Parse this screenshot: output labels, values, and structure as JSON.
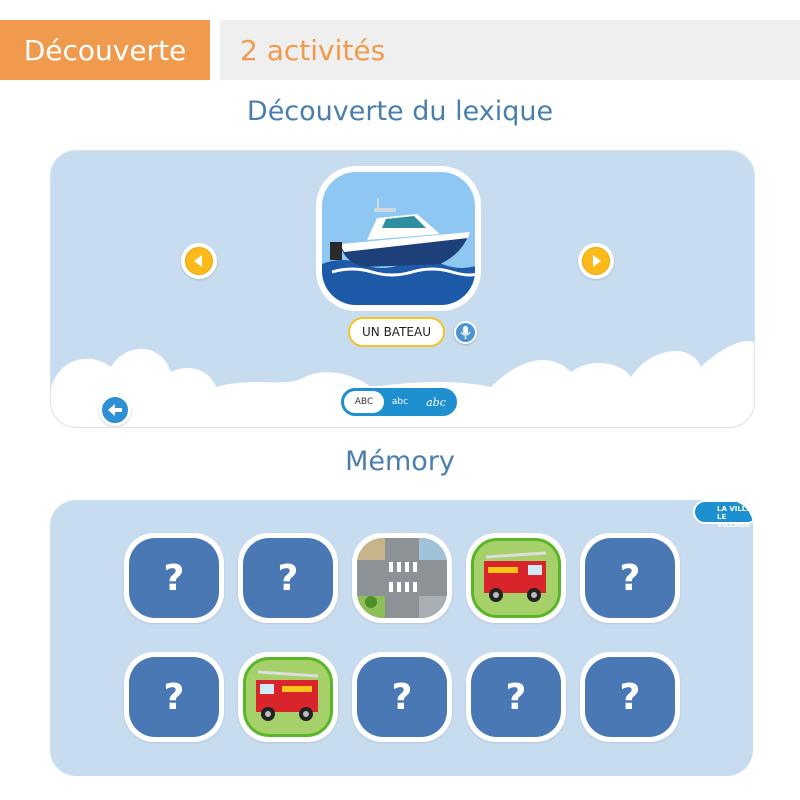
{
  "header": {
    "category": "Découverte",
    "activity_count": "2 activités"
  },
  "lexicon": {
    "title": "Découverte du lexique",
    "word": "UN BATEAU",
    "image_icon": "boat-image",
    "script_options": [
      "ABC",
      "abc",
      "abc"
    ],
    "selected_script": "ABC"
  },
  "memory": {
    "title": "Mémory",
    "level_badge": [
      "LA VILLE",
      "LE VILLAGE"
    ],
    "hidden_symbol": "?",
    "cards_row1": [
      "hidden",
      "hidden",
      "street-crossing",
      "fire-truck",
      "hidden"
    ],
    "cards_row2": [
      "hidden",
      "fire-truck",
      "hidden",
      "hidden",
      "hidden"
    ]
  },
  "colors": {
    "accent": "#ef9a4c",
    "panel": "#c8dcef",
    "card_back": "#4a78b5",
    "match_border": "#58b627"
  }
}
